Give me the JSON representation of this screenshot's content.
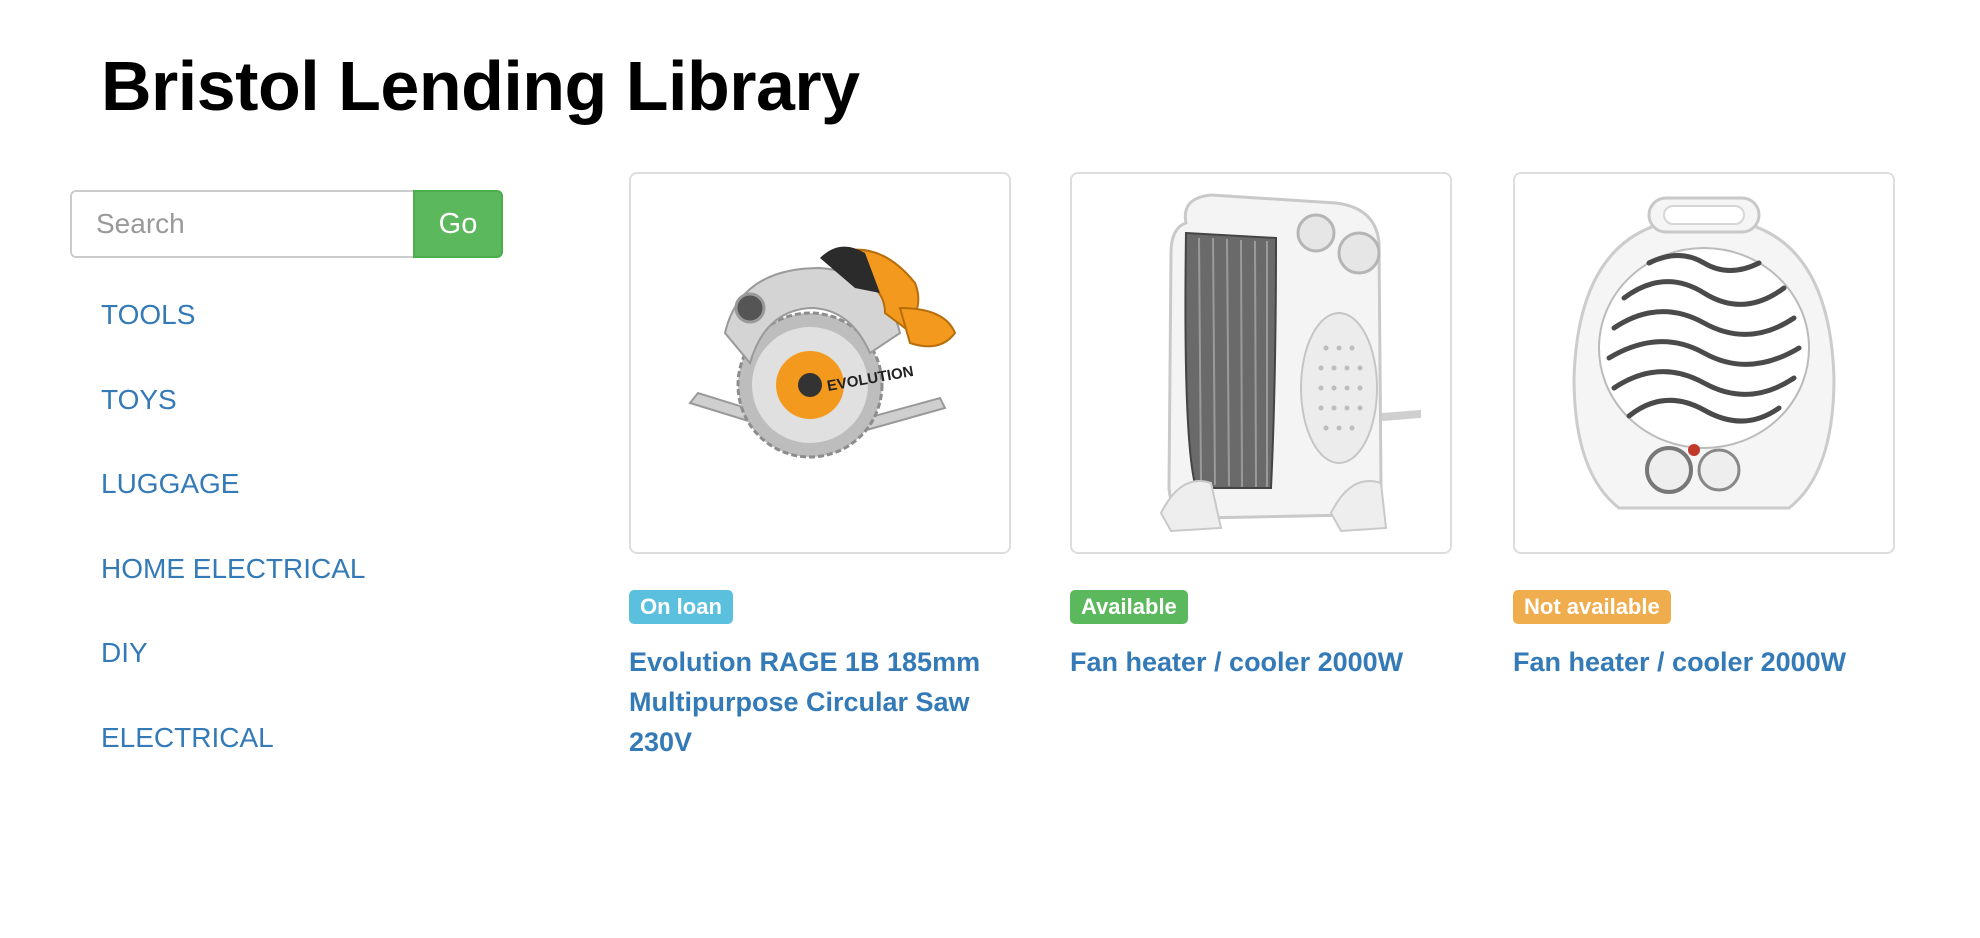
{
  "header": {
    "title": "Bristol Lending Library"
  },
  "search": {
    "placeholder": "Search",
    "value": "",
    "button_label": "Go"
  },
  "categories": [
    {
      "label": "TOOLS"
    },
    {
      "label": "TOYS"
    },
    {
      "label": "LUGGAGE"
    },
    {
      "label": "HOME ELECTRICAL"
    },
    {
      "label": "DIY"
    },
    {
      "label": "ELECTRICAL"
    }
  ],
  "items": [
    {
      "status": "On loan",
      "status_color": "#5bc0de",
      "title": "Evolution RAGE 1B 185mm Multipurpose Circular Saw 230V",
      "image": "circular-saw",
      "image_text": "EVOLUTION"
    },
    {
      "status": "Available",
      "status_color": "#5cb85c",
      "title": "Fan heater / cooler 2000W",
      "image": "upright-fan-heater"
    },
    {
      "status": "Not available",
      "status_color": "#f0ad4e",
      "title": "Fan heater / cooler 2000W",
      "image": "round-fan-heater"
    }
  ],
  "colors": {
    "link": "#337ab7",
    "go_button": "#5cb85c",
    "on_loan": "#5bc0de",
    "available": "#5cb85c",
    "not_available": "#f0ad4e"
  }
}
